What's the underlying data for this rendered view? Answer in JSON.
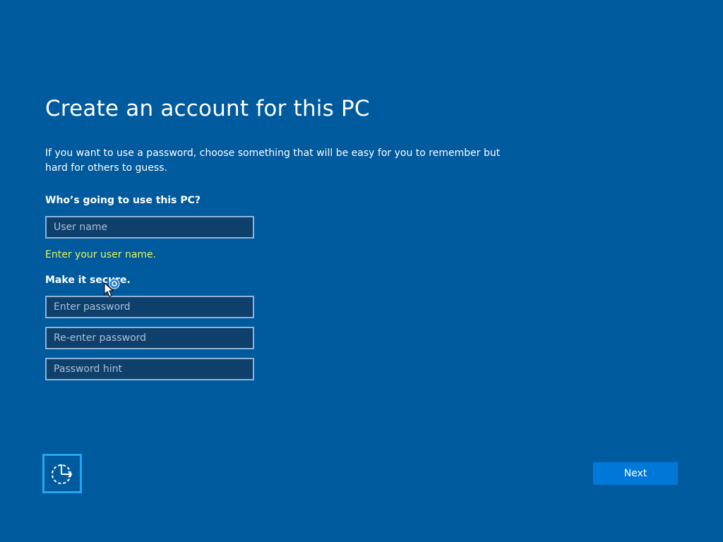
{
  "page": {
    "title": "Create an account for this PC",
    "description": "If you want to use a password, choose something that will be easy for you to remember but hard for others to guess."
  },
  "who_section": {
    "label": "Who’s going to use this PC?",
    "username_placeholder": "User name",
    "username_value": "",
    "validation_message": "Enter your user name."
  },
  "secure_section": {
    "label": "Make it secure.",
    "password_placeholder": "Enter password",
    "reenter_placeholder": "Re-enter password",
    "hint_placeholder": "Password hint"
  },
  "footer": {
    "ease_of_access_icon": "ease-of-access-icon",
    "next_label": "Next"
  },
  "colors": {
    "background": "#005a9e",
    "field_background": "#0f3f6b",
    "field_border": "#8fb4d6",
    "validation_text": "#e6f55a",
    "accent_button": "#0078d7",
    "focus_border": "#26a6f0"
  }
}
